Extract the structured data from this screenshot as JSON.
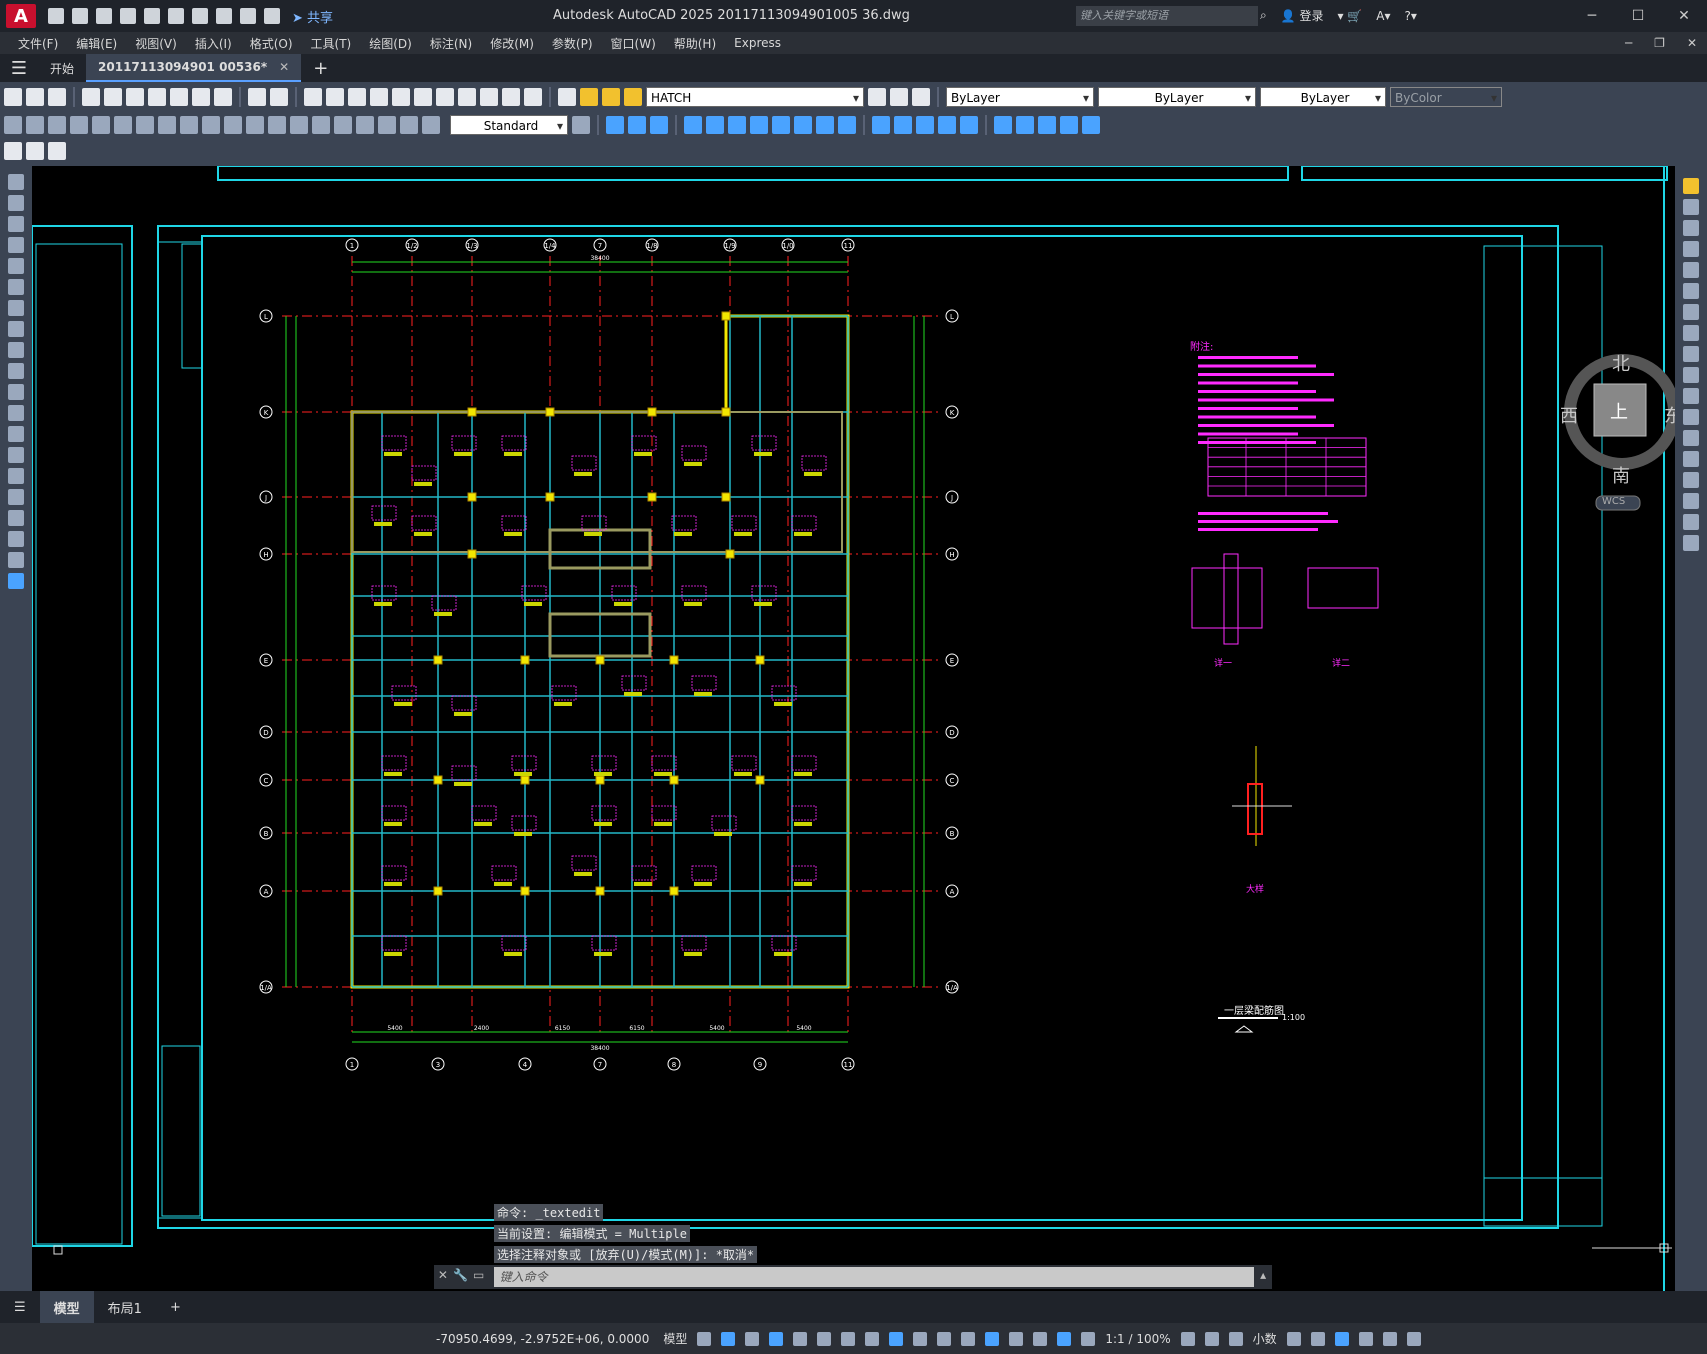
{
  "titlebar": {
    "app_letter": "A",
    "share_label": "共享",
    "title": "Autodesk AutoCAD 2025    20117113094901005 36.dwg",
    "search_placeholder": "键入关键字或短语",
    "login_label": "登录",
    "minimize_label": "─",
    "maximize_label": "☐",
    "close_label": "✕"
  },
  "menubar": {
    "items": [
      "文件(F)",
      "编辑(E)",
      "视图(V)",
      "插入(I)",
      "格式(O)",
      "工具(T)",
      "绘图(D)",
      "标注(N)",
      "修改(M)",
      "参数(P)",
      "窗口(W)",
      "帮助(H)",
      "Express"
    ]
  },
  "doc_tabs": {
    "menu_icon": "☰",
    "start_label": "开始",
    "active_file": "20117113094901 00536*",
    "close_mark": "✕",
    "new_tab": "+"
  },
  "toolbar": {
    "layer_name": "HATCH",
    "text_style": "Standard",
    "color": "ByLayer",
    "linetype": "ByLayer",
    "lineweight": "ByLayer",
    "plotstyle": "ByColor"
  },
  "viewcube": {
    "north": "北",
    "south": "南",
    "east": "东",
    "west": "西",
    "top": "上",
    "wcs": "WCS"
  },
  "drawing": {
    "axis_top": [
      "1",
      "1/2",
      "1/3",
      "1/4",
      "7",
      "1/8",
      "1/9",
      "1/0",
      "11"
    ],
    "axis_bottom": [
      "1",
      "3",
      "4",
      "7",
      "8",
      "9",
      "11"
    ],
    "axis_left": [
      "L",
      "K",
      "J",
      "H",
      "E",
      "D",
      "C",
      "B",
      "A",
      "1/A"
    ],
    "dim_top_total": "38400",
    "dim_bottom_total": "38400",
    "dim_bottom": [
      "5400",
      "2400",
      "6150",
      "6150",
      "5400",
      "5400"
    ],
    "notes_title": "附注:",
    "plan_title": "一层梁配筋图",
    "plan_scale": "1:100",
    "section_labels": [
      "详一",
      "详二",
      "大样"
    ]
  },
  "commandline": {
    "history": [
      "命令: _textedit",
      "当前设置: 编辑模式 = Multiple",
      "选择注释对象或 [放弃(U)/模式(M)]: *取消*"
    ],
    "placeholder": "键入命令"
  },
  "layout_tabs": {
    "menu_icon": "☰",
    "model": "模型",
    "layout1": "布局1",
    "add": "+"
  },
  "statusbar": {
    "coords": "-70950.4699, -2.9752E+06, 0.0000",
    "space": "模型",
    "scale": "1:1 / 100%",
    "units": "小数"
  },
  "colors": {
    "drawing_bg": "#000000",
    "frame_cyan": "#1fd6e6",
    "wall_yellow": "#f2e600",
    "text_magenta": "#ff2bff",
    "axis_red": "#ff2020",
    "dim_green": "#22dd22",
    "beam_cyan": "#22b8c8",
    "ui_dark": "#1f232a",
    "ui_panel": "#3b4453"
  }
}
